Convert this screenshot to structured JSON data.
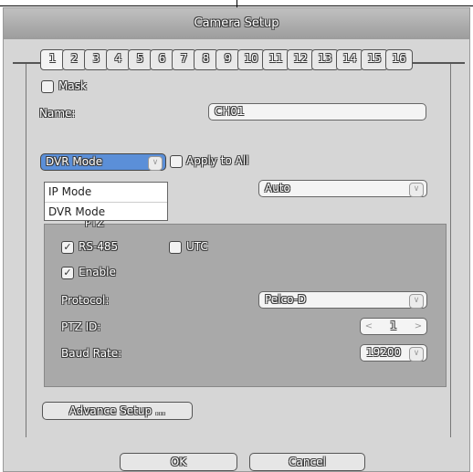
{
  "window": {
    "title": "Camera Setup"
  },
  "tabs": [
    "1",
    "2",
    "3",
    "4",
    "5",
    "6",
    "7",
    "8",
    "9",
    "10",
    "11",
    "12",
    "13",
    "14",
    "15",
    "16"
  ],
  "mask": {
    "label": "Mask",
    "checked": false
  },
  "name": {
    "label": "Name:",
    "value": "CH01"
  },
  "mode": {
    "selected": "DVR Mode",
    "options": [
      "IP Mode",
      "DVR Mode"
    ]
  },
  "apply_all": {
    "label": "Apply to All",
    "checked": false
  },
  "auto_dropdown": {
    "value": "Auto"
  },
  "ptz": {
    "title": "PTZ",
    "rs485": {
      "label": "RS-485",
      "checked": true
    },
    "utc": {
      "label": "UTC",
      "checked": false
    },
    "enable": {
      "label": "Enable",
      "checked": true
    },
    "protocol": {
      "label": "Protocol:",
      "value": "Pelco-D"
    },
    "ptz_id": {
      "label": "PTZ ID:",
      "value": "1"
    },
    "baud_rate": {
      "label": "Baud Rate:",
      "value": "19200"
    }
  },
  "buttons": {
    "advance": "Advance Setup ...",
    "ok": "OK",
    "cancel": "Cancel"
  },
  "icons": {
    "check": "✓",
    "dropdown": "chevron-down-icon",
    "left": "chevron-left-icon",
    "right": "chevron-right-icon"
  }
}
